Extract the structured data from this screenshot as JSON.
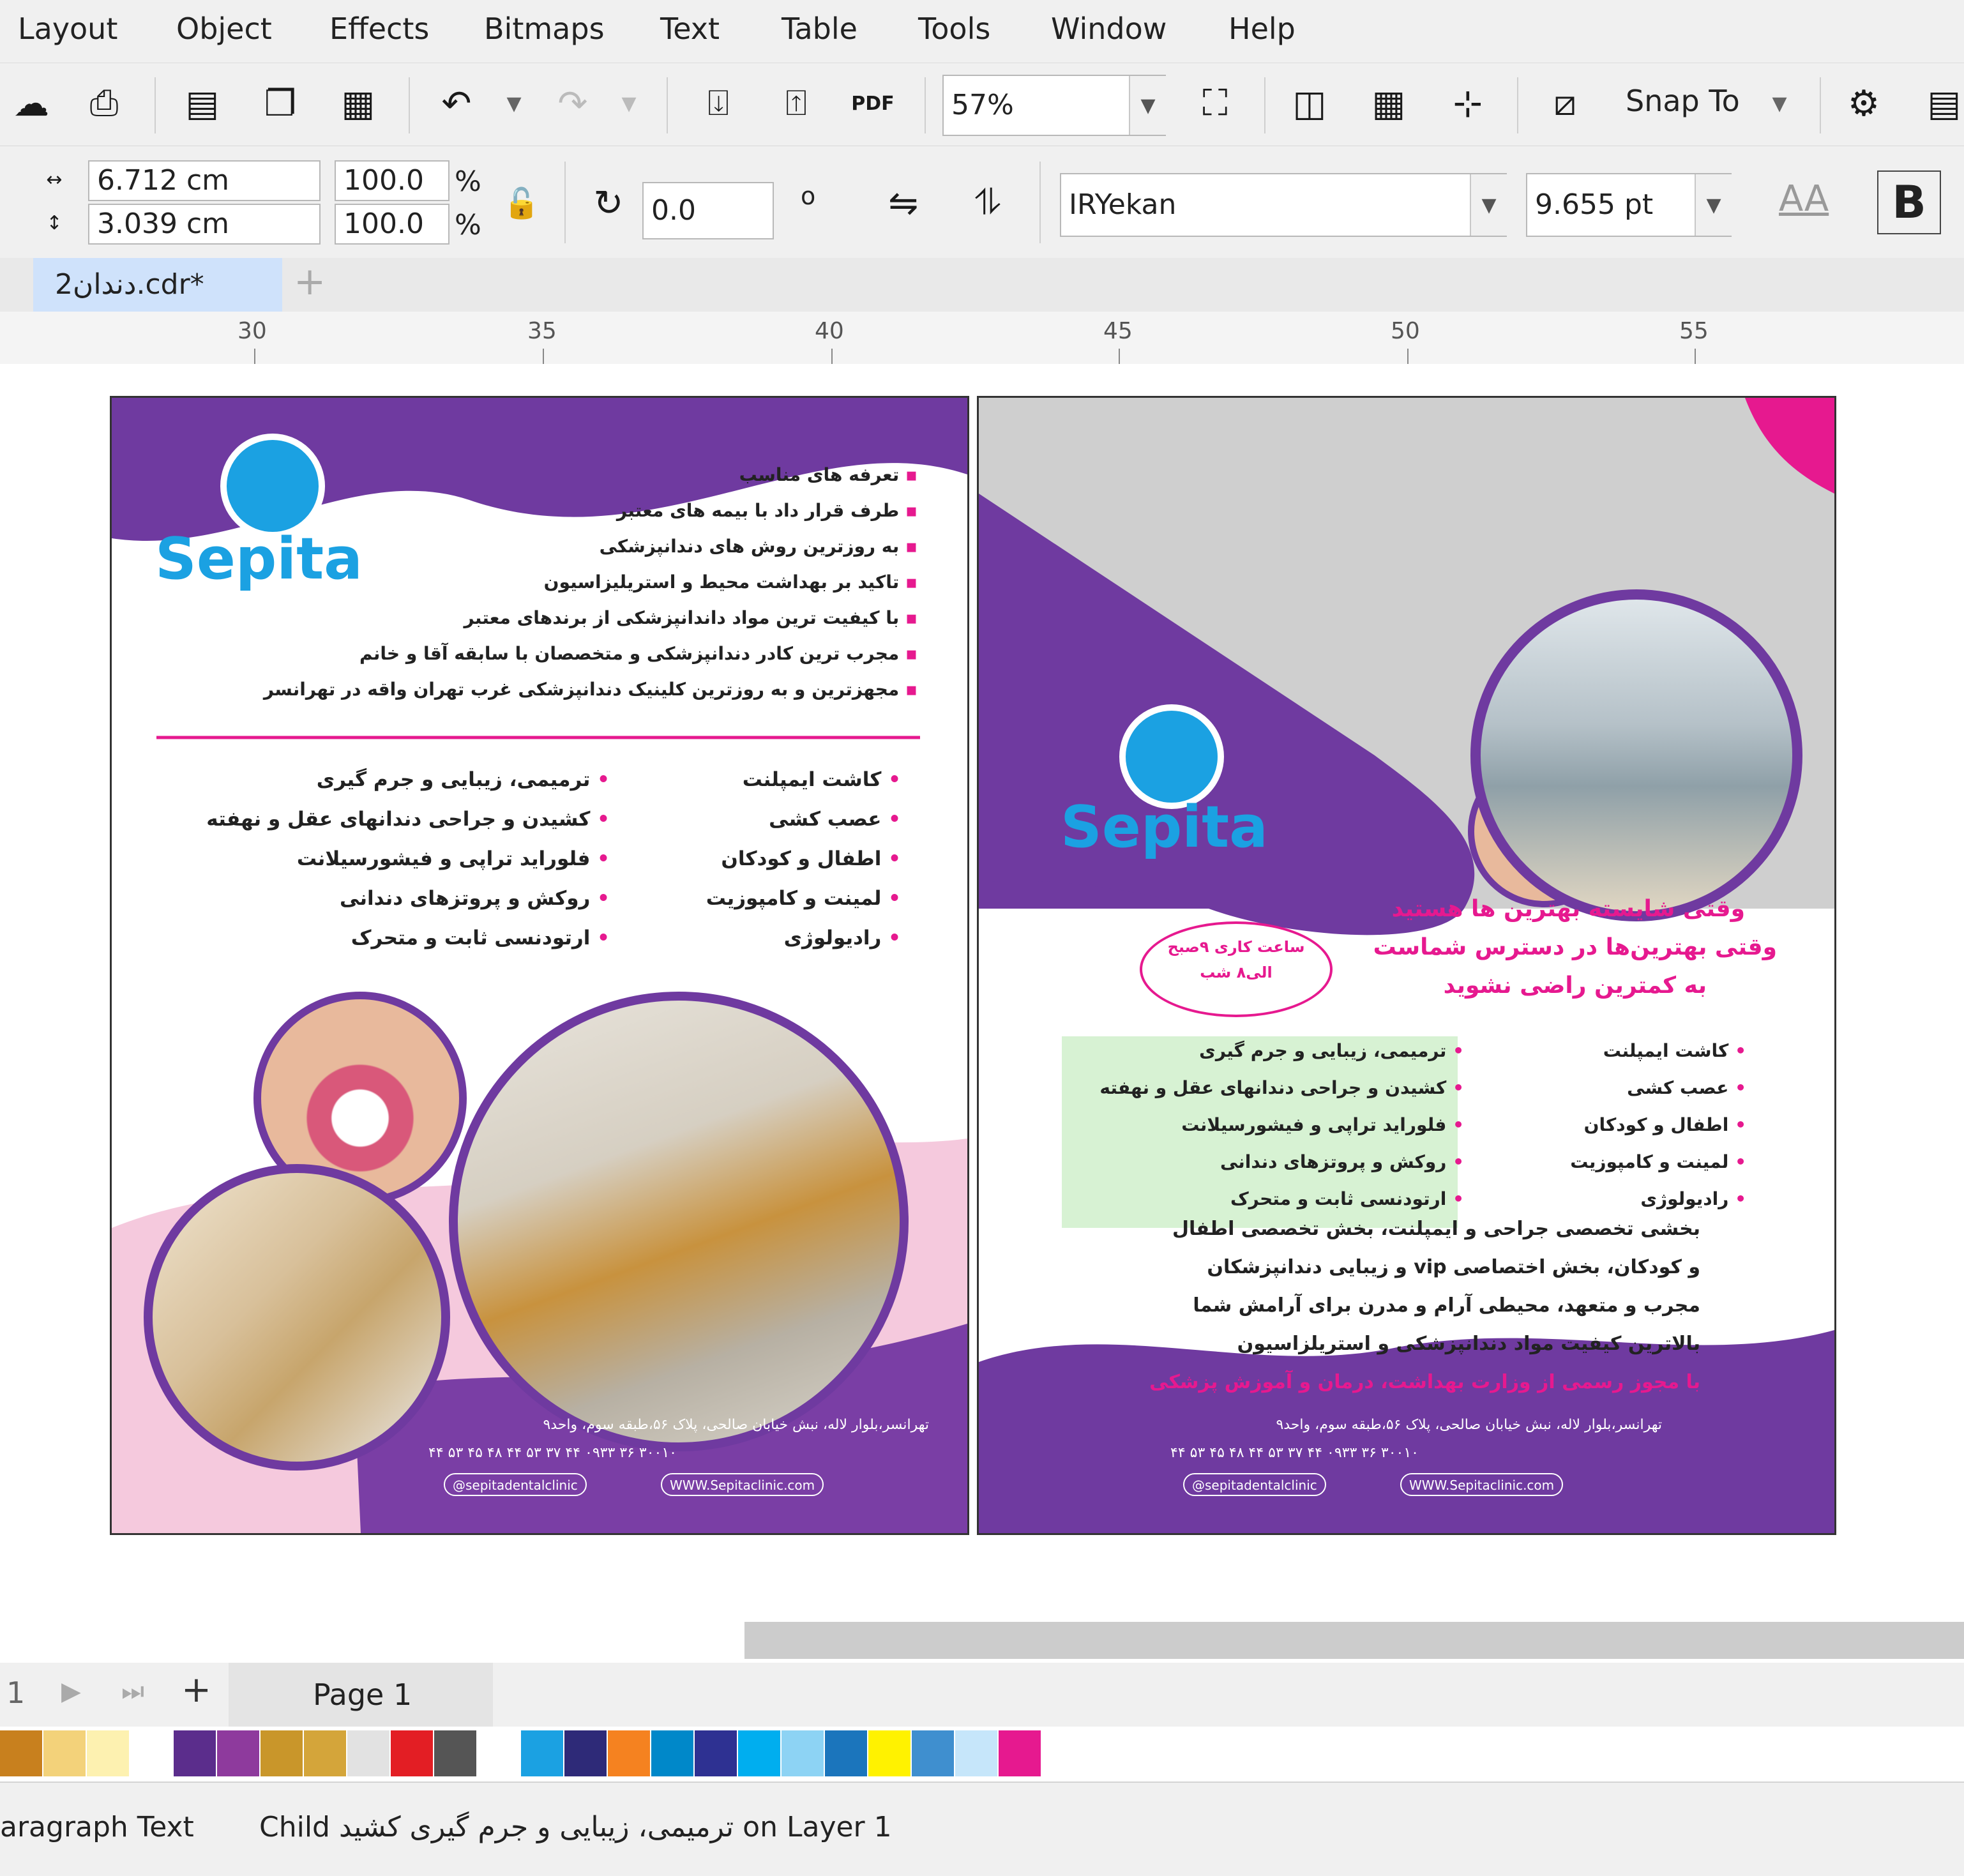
{
  "menu": [
    "Layout",
    "Object",
    "Effects",
    "Bitmaps",
    "Text",
    "Table",
    "Tools",
    "Window",
    "Help"
  ],
  "toolbar": {
    "zoom": "57%",
    "snap_label": "Snap To",
    "pdf_label": "PDF"
  },
  "property_bar": {
    "width": "6.712 cm",
    "height": "3.039 cm",
    "scale_x": "100.0",
    "scale_y": "100.0",
    "percent": "%",
    "rotation": "0.0",
    "degree": "o",
    "font": "IRYekan",
    "font_size": "9.655 pt",
    "bold": "B",
    "aa": "AA"
  },
  "tab": {
    "title": "دندان2.cdr*",
    "add": "+"
  },
  "ruler": [
    "30",
    "35",
    "40",
    "45",
    "50",
    "55"
  ],
  "left_page": {
    "logo": "Sepita",
    "bullets": [
      "تعرفه های مناسب",
      "طرف قرار داد با بیمه های معتبر",
      "به روزترین روش های دندانپزشکی",
      "تاکید بر بهداشت محیط و استریلیزاسیون",
      "با کیفیت ترین مواد داندانپزشکی از برندهای معتبر",
      "مجرب ترین کادر دندانپزشکی و متخصصان با سابقه آقا و خانم",
      "مجهزترین و به روزترین کلینیک دندانپزشکی غرب تهران واقه در تهرانسر"
    ],
    "services_right": [
      "کاشت ایمپلنت",
      "عصب کشی",
      "اطفال و کودکان",
      "لمینت و کامپوزیت",
      "رادیولوژی"
    ],
    "services_left": [
      "ترمیمی، زیبایی و جرم گیری",
      "کشیدن و جراحی دندانهای عقل و نهفته",
      "فلوراید تراپی و فیشورسیلانت",
      "روکش و پروتزهای دندانی",
      "ارتودنسی ثابت و متحرک"
    ],
    "address": "تهرانسر،بلوار لاله، نبش خیابان صالحی، پلاک ۵۶،طبقه سوم، واحد۹",
    "phones": "۴۴ ۵۳ ۴۵ ۴۸   ۴۴ ۵۳ ۳۷ ۴۴   ۰۹۳۳ ۳۶ ۳۰۰۱۰",
    "instagram": "@sepitadentalclinic",
    "web": "WWW.Sepitaclinic.com"
  },
  "right_page": {
    "logo": "Sepita",
    "hours": [
      "ساعت کاری ۹صبح",
      "الی۸ شب"
    ],
    "headline": [
      "وقتی شایسته بهترین ها هستید",
      "وقتی بهترین‌ها در دسترس شماست",
      "به کمترین راضی نشوید"
    ],
    "services_right": [
      "کاشت ایمپلنت",
      "عصب کشی",
      "اطفال و کودکان",
      "لمینت و کامپوزیت",
      "رادیولوژی"
    ],
    "services_left": [
      "ترمیمی، زیبایی و جرم گیری",
      "کشیدن و جراحی دندانهای عقل و نهفته",
      "فلوراید تراپی و فیشورسیلانت",
      "روکش و پروتزهای دندانی",
      "ارتودنسی ثابت و متحرک"
    ],
    "paragraph": [
      "بخشی تخصصی جراحی و ایمپلنت، بخش تخصصی اطفال",
      "و کودکان، بخش اختصاصی vip و زیبایی دندانپزشکان",
      "مجرب و متعهد، محیطی آرام و مدرن برای آرامش شما",
      "بالاترین کیفیت مواد دندانپزشکی و استریلزاسیون"
    ],
    "license": "با مجوز رسمی از وزارت بهداشت، درمان و آموزش پزشکی",
    "address": "تهرانسر،بلوار لاله، نبش خیابان صالحی، پلاک ۵۶،طبقه سوم، واحد۹",
    "phones": "۴۴ ۵۳ ۴۵ ۴۸   ۴۴ ۵۳ ۳۷ ۴۴   ۰۹۳۳ ۳۶ ۳۰۰۱۰",
    "instagram": "@sepitadentalclinic",
    "web": "WWW.Sepitaclinic.com"
  },
  "pagebar": {
    "page_num": "1",
    "add": "+",
    "page_tab": "Page 1"
  },
  "palette": [
    "#c8801e",
    "#f3d27a",
    "#fdf1b0",
    "#ffffff",
    "#5b2d8c",
    "#8e3a9d",
    "#c9962a",
    "#d4a53a",
    "#e2e2e2",
    "#e31e24",
    "#555555",
    "#ffffff",
    "#1ba1e2",
    "#2e2a78",
    "#f58220",
    "#0088c9",
    "#2e3192",
    "#00aeef",
    "#8dd3f4",
    "#1b75bc",
    "#fff200",
    "#3f8fcf",
    "#c6e6fa",
    "#e6198f"
  ],
  "status": {
    "left": "aragraph Text",
    "right": "Child ترمیمی، زیبایی و جرم گیری کشید on Layer 1"
  },
  "colors": {
    "purple": "#6f3aa0",
    "magenta": "#e6198f",
    "blue": "#1ba1e2"
  }
}
